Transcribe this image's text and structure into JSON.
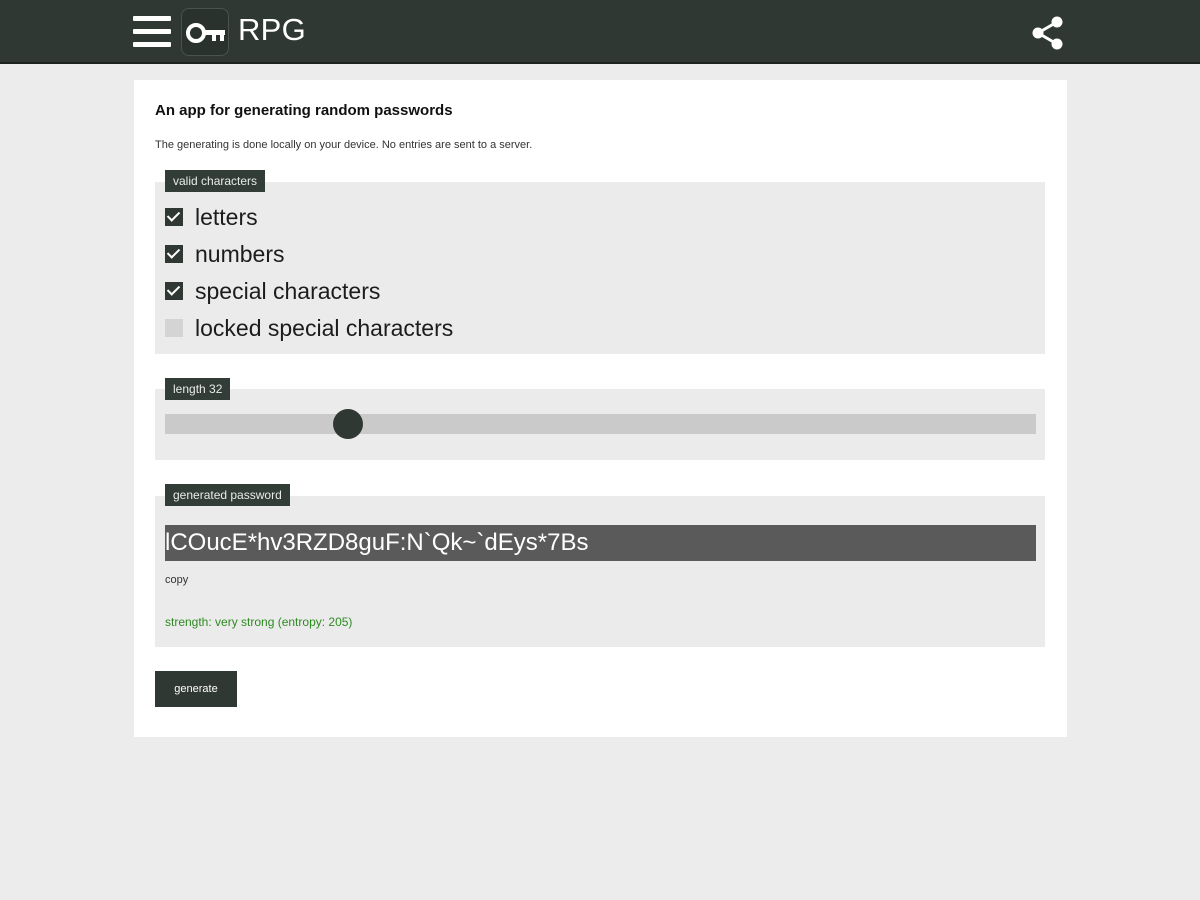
{
  "header": {
    "app_title": "RPG",
    "menu_icon": "hamburger-menu-icon",
    "logo_icon": "key-icon",
    "share_icon": "share-icon",
    "background_color": "#2f3833"
  },
  "main": {
    "heading": "An app for generating random passwords",
    "subtext": "The generating is done locally on your device. No entries are sent to a server.",
    "valid_characters": {
      "legend": "valid characters",
      "options": [
        {
          "label": "letters",
          "checked": true
        },
        {
          "label": "numbers",
          "checked": true
        },
        {
          "label": "special characters",
          "checked": true
        },
        {
          "label": "locked special characters",
          "checked": false
        }
      ]
    },
    "length": {
      "legend": "length 32",
      "value": 32,
      "slider_fraction": 0.21
    },
    "generated_password": {
      "legend": "generated password",
      "value": "lCOucE*hv3RZD8guF:N`Qk~`dEys*7Bs",
      "copy_label": "copy",
      "strength": "strength: very strong (entropy: 205)",
      "strength_color": "#2e8b22"
    },
    "generate_button": "generate"
  }
}
